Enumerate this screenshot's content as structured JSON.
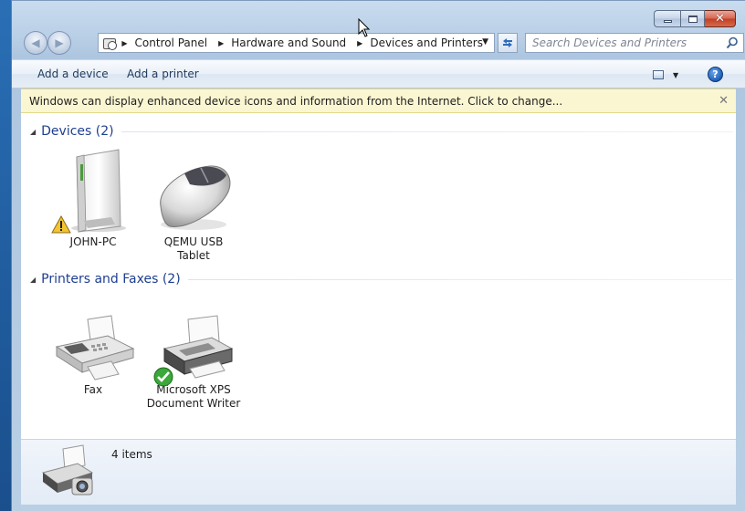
{
  "window": {
    "caption_buttons": [
      "minimize",
      "maximize",
      "close"
    ]
  },
  "nav": {
    "breadcrumb": [
      "Control Panel",
      "Hardware and Sound",
      "Devices and Printers"
    ],
    "search_placeholder": "Search Devices and Printers"
  },
  "toolbar": {
    "add_device_label": "Add a device",
    "add_printer_label": "Add a printer"
  },
  "info_bar": {
    "message": "Windows can display enhanced device icons and information from the Internet. Click to change..."
  },
  "groups": {
    "devices": {
      "title": "Devices (2)",
      "items": [
        {
          "label_lines": [
            "JOHN-PC"
          ],
          "icon": "computer-icon",
          "badge": "warning-icon"
        },
        {
          "label_lines": [
            "QEMU USB",
            "Tablet"
          ],
          "icon": "mouse-icon"
        }
      ]
    },
    "printers": {
      "title": "Printers and Faxes (2)",
      "items": [
        {
          "label_lines": [
            "Fax"
          ],
          "icon": "fax-icon"
        },
        {
          "label_lines": [
            "Microsoft XPS",
            "Document Writer"
          ],
          "icon": "printer-icon",
          "badge": "default-check-icon"
        }
      ]
    }
  },
  "details": {
    "count": "4 items"
  },
  "colors": {
    "group_title": "#1e3f8f",
    "info_bar_bg": "#fbf6d2",
    "command_text": "#1e395b",
    "close_button": "#c13f24"
  }
}
